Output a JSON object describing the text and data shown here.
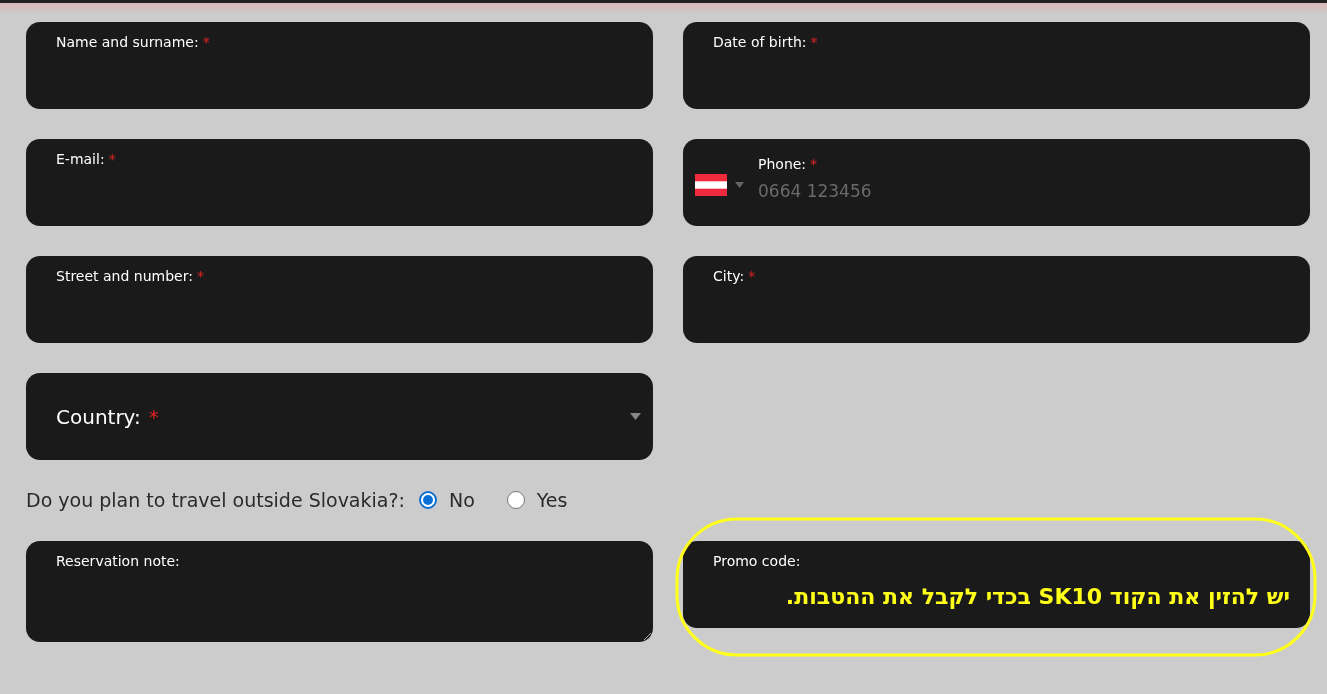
{
  "rows": [
    {
      "kind": "fields",
      "fields": [
        {
          "kind": "text",
          "label": "Name and surname:",
          "required_mark": "*"
        },
        {
          "kind": "text",
          "label": "Date of birth:",
          "required_mark": "*"
        }
      ]
    },
    {
      "kind": "fields",
      "fields": [
        {
          "kind": "text",
          "label": "E-mail:",
          "required_mark": "*"
        },
        {
          "kind": "phone",
          "label": "Phone:",
          "required_mark": "*",
          "placeholder": "0664 123456"
        }
      ]
    },
    {
      "kind": "fields",
      "fields": [
        {
          "kind": "text",
          "label": "Street and number:",
          "required_mark": "*"
        },
        {
          "kind": "text",
          "label": "City:",
          "required_mark": "*"
        }
      ]
    },
    {
      "kind": "fields",
      "fields": [
        {
          "kind": "select",
          "label": "Country:",
          "required_mark": "*"
        }
      ]
    },
    {
      "kind": "question",
      "label": "Do you plan to travel outside Slovakia?:",
      "options": [
        {
          "label": "No",
          "selected": true
        },
        {
          "label": "Yes",
          "selected": false
        }
      ]
    },
    {
      "kind": "fields",
      "fields": [
        {
          "kind": "textarea",
          "label": "Reservation note:"
        },
        {
          "kind": "promo",
          "label": "Promo code:",
          "annotation": "יש להזין את הקוד SK10 בכדי לקבל את ההטבות."
        }
      ]
    }
  ]
}
